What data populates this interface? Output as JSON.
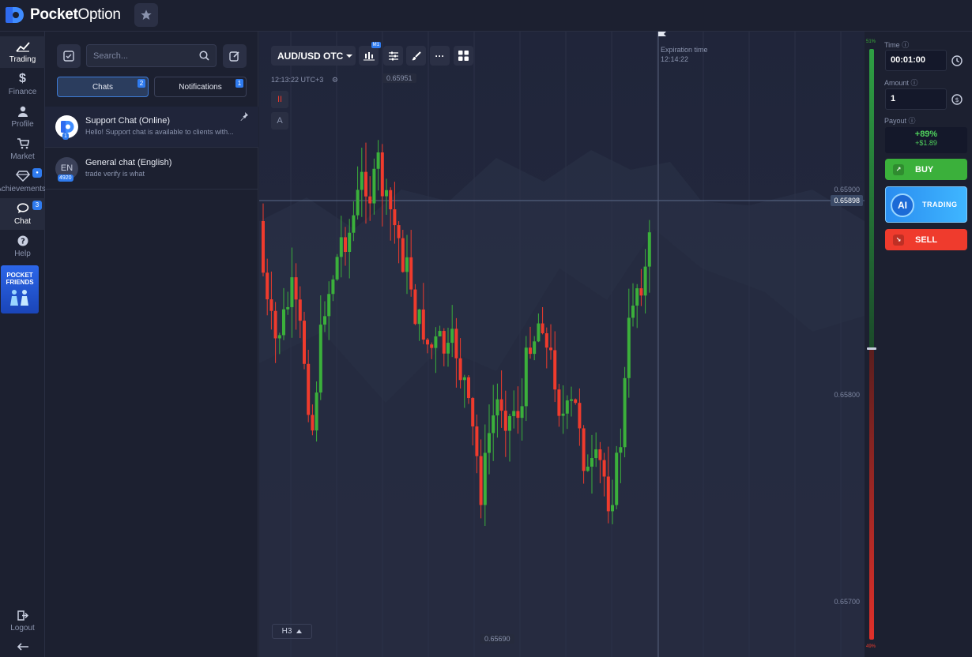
{
  "brand": {
    "name_bold": "Pocket",
    "name_light": "Option"
  },
  "nav": {
    "items": [
      {
        "label": "Trading",
        "icon": "chart-line-icon"
      },
      {
        "label": "Finance",
        "icon": "dollar-icon"
      },
      {
        "label": "Profile",
        "icon": "user-icon"
      },
      {
        "label": "Market",
        "icon": "cart-icon"
      },
      {
        "label": "Achievements",
        "icon": "diamond-icon",
        "badge": "●"
      },
      {
        "label": "Chat",
        "icon": "chat-icon",
        "badge": "3"
      },
      {
        "label": "Help",
        "icon": "help-icon"
      }
    ],
    "pocket_friends": "POCKET FRIENDS",
    "logout": "Logout"
  },
  "chat": {
    "search_placeholder": "Search...",
    "tabs": [
      {
        "label": "Chats",
        "badge": "2"
      },
      {
        "label": "Notifications",
        "badge": "1"
      }
    ],
    "rows": [
      {
        "name": "Support Chat (Online)",
        "preview": "Hello! Support chat is available to clients with...",
        "avatar_badge": "1"
      },
      {
        "name": "General chat (English)",
        "preview": "trade verify is what",
        "avatar_text": "EN",
        "avatar_badge": "4920"
      }
    ]
  },
  "chart": {
    "asset": "AUD/USD OTC",
    "timeframe_badge": "M1",
    "clock": "12:13:22 UTC+3",
    "tool_top": "II",
    "tool_bottom": "A",
    "high_tag": "0.65951",
    "low_tag": "0.65690",
    "y_labels": [
      "0.65900",
      "0.65800",
      "0.65700"
    ],
    "current_price": "0.65898",
    "expiration_label": "Expiration time",
    "expiration_time": "12:14:22",
    "timeframe_btn": "H3"
  },
  "sentiment": {
    "up": "51%",
    "down": "49%"
  },
  "trade": {
    "time_label": "Time",
    "time_value": "00:01:00",
    "amount_label": "Amount",
    "amount_value": "1",
    "payout_label": "Payout",
    "payout_percent": "+89%",
    "payout_money": "+$1.89",
    "buy": "BUY",
    "ai_circle": "AI",
    "ai_text": "TRADING",
    "sell": "SELL"
  },
  "colors": {
    "up": "#3bb03b",
    "down": "#ef3b2d",
    "accent": "#2f7bef",
    "bg": "#1f2333"
  }
}
